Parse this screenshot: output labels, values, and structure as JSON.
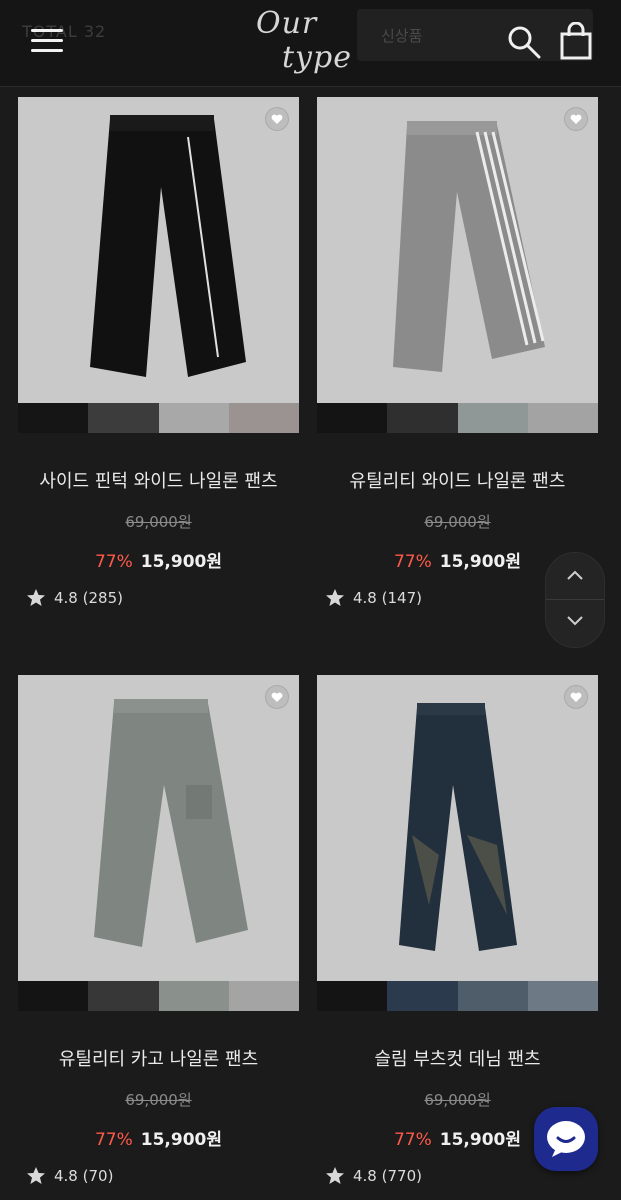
{
  "header": {
    "total_label": "TOTAL 32",
    "logo_line1": "Our",
    "logo_line2": "type",
    "search_placeholder": "신상품"
  },
  "products": [
    {
      "name": "사이드 핀턱 와이드 나일론 팬츠",
      "original_price": "69,000원",
      "discount": "77%",
      "price": "15,900원",
      "rating": "4.8",
      "reviews": "(285)"
    },
    {
      "name": "유틸리티 와이드 나일론 팬츠",
      "original_price": "69,000원",
      "discount": "77%",
      "price": "15,900원",
      "rating": "4.8",
      "reviews": "(147)"
    },
    {
      "name": "유틸리티 카고 나일론 팬츠",
      "original_price": "69,000원",
      "discount": "77%",
      "price": "15,900원",
      "rating": "4.8",
      "reviews": "(70)"
    },
    {
      "name": "슬림 부츠컷 데님 팬츠",
      "original_price": "69,000원",
      "discount": "77%",
      "price": "15,900원",
      "rating": "4.8",
      "reviews": "(770)"
    }
  ],
  "icons": {
    "menu": "hamburger-menu-icon",
    "search": "search-icon",
    "cart": "shopping-bag-icon",
    "heart": "heart-icon",
    "star": "star-icon",
    "up": "chevron-up-icon",
    "down": "chevron-down-icon",
    "chat": "chat-icon"
  },
  "colors": {
    "background": "#1b1b1b",
    "discount": "#ff5a4a",
    "chat": "#1f2a8f"
  }
}
